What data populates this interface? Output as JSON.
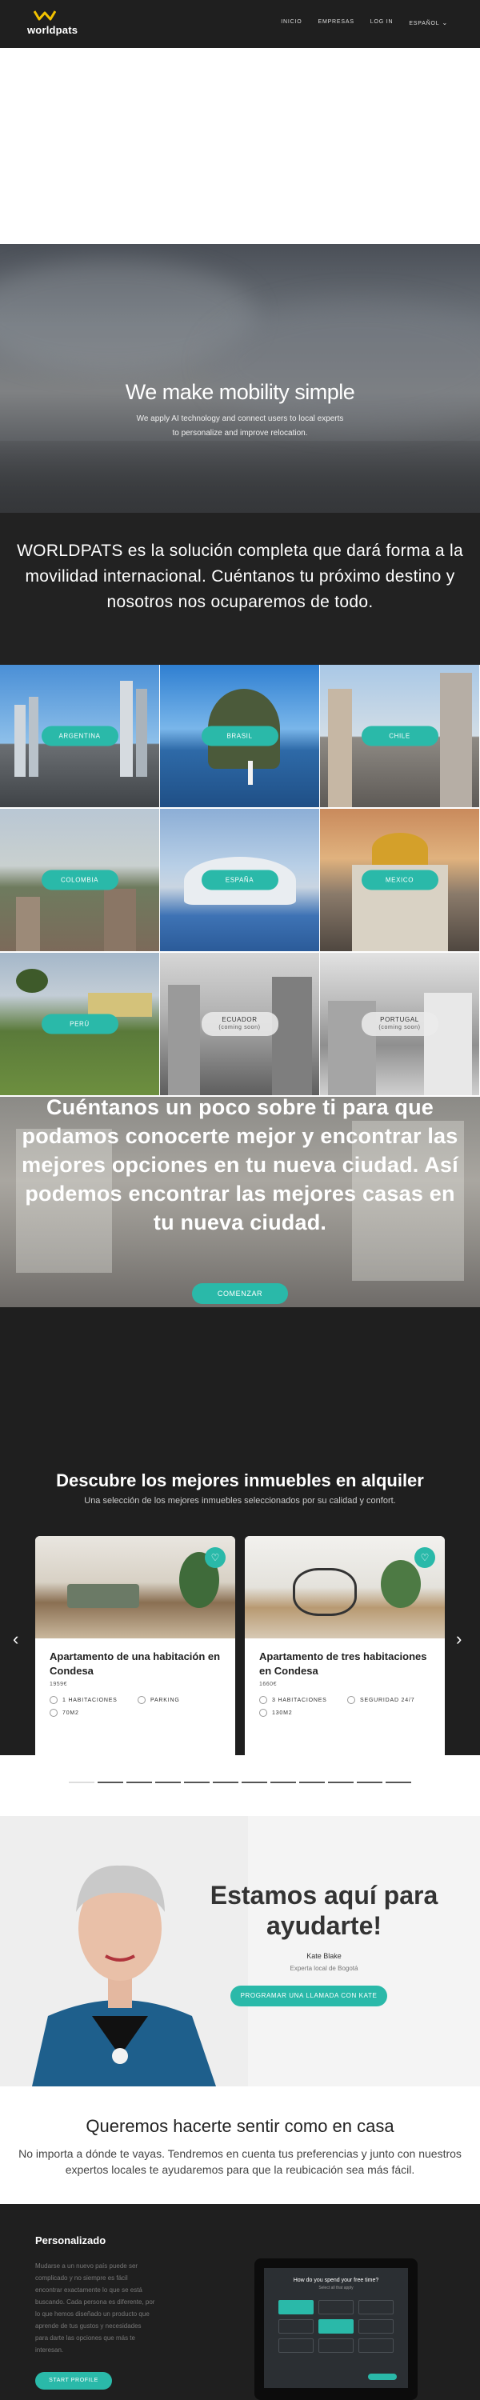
{
  "header": {
    "brand": "worldpats",
    "nav": [
      "INICIO",
      "EMPRESAS",
      "LOG IN",
      "ESPAÑOL"
    ]
  },
  "hero": {
    "title": "We make mobility simple",
    "subtitle_lines": [
      "We apply AI technology and connect users to local experts",
      "to personalize and improve relocation."
    ]
  },
  "intro": {
    "text": "WORLDPATS es la solución completa que dará forma a la movilidad internacional. Cuéntanos tu próximo destino y nosotros nos ocuparemos de todo."
  },
  "countries": [
    {
      "name": "ARGENTINA",
      "soon": ""
    },
    {
      "name": "BRASIL",
      "soon": ""
    },
    {
      "name": "CHILE",
      "soon": ""
    },
    {
      "name": "COLOMBIA",
      "soon": ""
    },
    {
      "name": "ESPAÑA",
      "soon": ""
    },
    {
      "name": "MEXICO",
      "soon": ""
    },
    {
      "name": "PERÚ",
      "soon": ""
    },
    {
      "name": "ECUADOR",
      "soon": "(coming soon)"
    },
    {
      "name": "PORTUGAL",
      "soon": "(coming soon)"
    }
  ],
  "about": {
    "text": "Cuéntanos un poco sobre ti para que podamos conocerte mejor y encontrar las mejores opciones en tu nueva ciudad. Así podemos encontrar las mejores casas en tu nueva ciudad.",
    "button": "COMENZAR"
  },
  "listings": {
    "title": "Descubre los mejores inmuebles en alquiler",
    "subtitle": "Una selección de los mejores inmuebles seleccionados por su calidad y confort.",
    "cards": [
      {
        "title": "Apartamento de una habitación en Condesa",
        "price": "1959€",
        "features": [
          "1 HABITACIONES",
          "PARKING",
          "70M2"
        ]
      },
      {
        "title": "Apartamento de tres habitaciones en Condesa",
        "price": "1660€",
        "features": [
          "3 HABITACIONES",
          "SEGURIDAD 24/7",
          "130M2"
        ]
      }
    ],
    "prev": "‹",
    "next": "›"
  },
  "help": {
    "title": "Estamos aquí para ayudarte!",
    "name": "Kate Blake",
    "role": "Experta local de Bogotá",
    "button": "PROGRAMAR UNA LLAMADA CON KATE"
  },
  "feel": {
    "title": "Queremos hacerte sentir como en casa",
    "text": "No importa a dónde te vayas. Tendremos en cuenta tus preferencias y junto con nuestros expertos locales te ayudaremos para que la reubicación sea más fácil."
  },
  "personalizado": {
    "title": "Personalizado",
    "text": "Mudarse a un nuevo país puede ser complicado y no siempre es fácil encontrar exactamente lo que se está buscando. Cada persona es diferente, por lo que hemos diseñado un producto que aprende de tus gustos y necesidades para darte las opciones que más te interesan.",
    "button": "START PROFILE",
    "screen_question": "How do you spend your free time?",
    "screen_hint": "Select all that apply"
  },
  "colors": {
    "accent": "#2ab9a9",
    "dark": "#1f1f1f"
  }
}
